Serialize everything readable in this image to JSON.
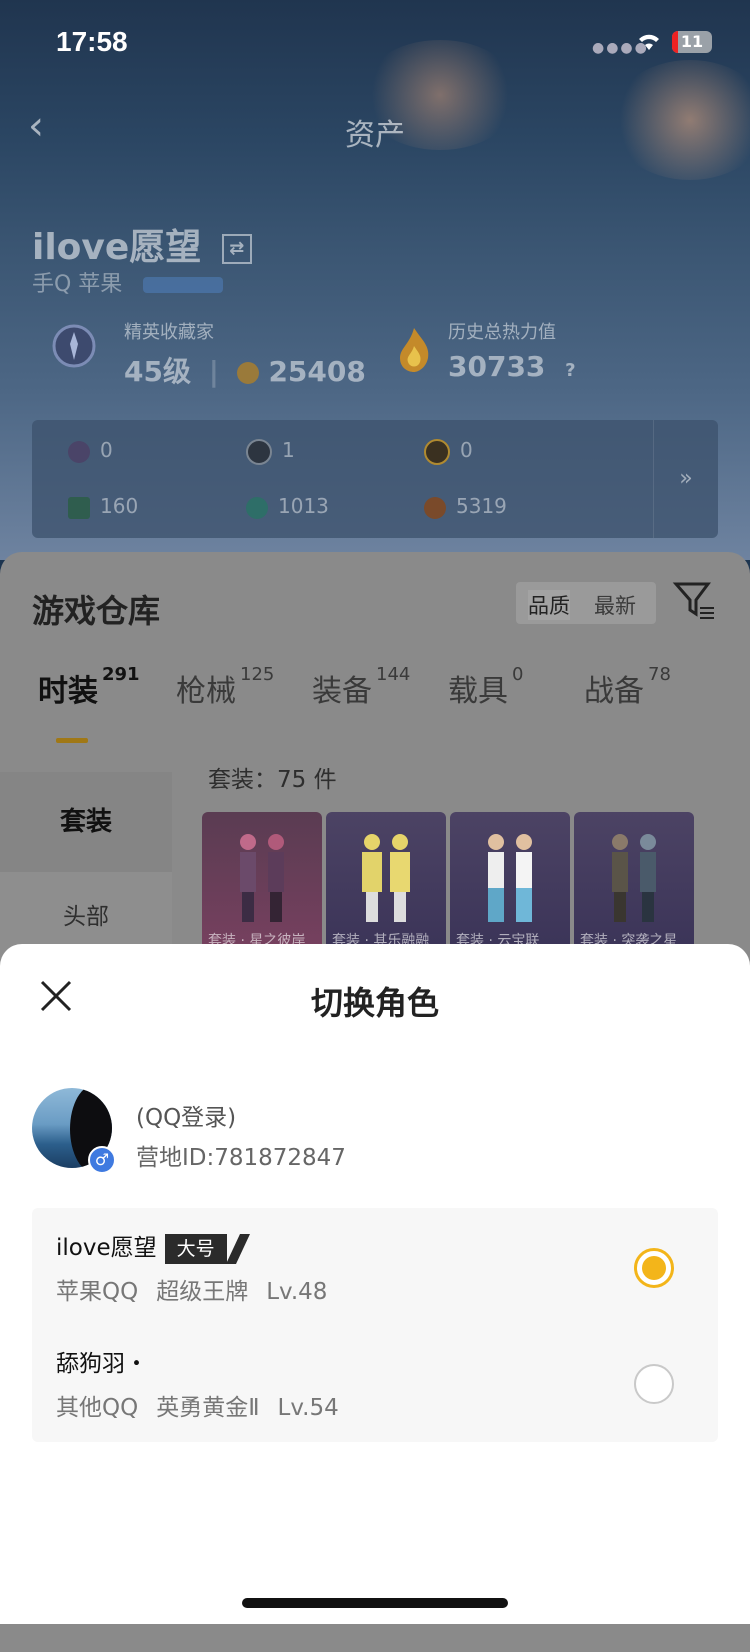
{
  "status_bar": {
    "time": "17:58",
    "battery": "11"
  },
  "nav": {
    "title": "资产",
    "back_icon": "chevron-left-icon"
  },
  "player": {
    "name": "ilove愿望",
    "platform": "手Q 苹果",
    "collector_label": "精英收藏家",
    "collector_level": "45级",
    "collector_points": "25408",
    "heat_label": "历史总热力值",
    "heat_value": "30733",
    "heat_help": "?"
  },
  "resources": {
    "items": [
      {
        "icon": "card-icon",
        "value": "0"
      },
      {
        "icon": "coin-icon",
        "value": "1"
      },
      {
        "icon": "medal-icon",
        "value": "0"
      },
      {
        "icon": "ticket-icon",
        "value": "160"
      },
      {
        "icon": "orb-icon",
        "value": "1013"
      },
      {
        "icon": "gem-icon",
        "value": "5319"
      }
    ],
    "more": "»"
  },
  "warehouse": {
    "title": "游戏仓库",
    "sort": {
      "quality": "品质",
      "newest": "最新"
    },
    "tabs": [
      {
        "label": "时装",
        "count": "291"
      },
      {
        "label": "枪械",
        "count": "125"
      },
      {
        "label": "装备",
        "count": "144"
      },
      {
        "label": "载具",
        "count": "0"
      },
      {
        "label": "战备",
        "count": "78"
      }
    ],
    "side": {
      "item_1": "套装",
      "item_2": "头部"
    },
    "set_count": "套装：75 件",
    "cards": [
      {
        "caption": "套装 · 星之彼岸"
      },
      {
        "caption": "套装 · 其乐融融"
      },
      {
        "caption": "套装 · 云宝联"
      },
      {
        "caption": "套装 · 突袭之星"
      }
    ]
  },
  "sheet": {
    "title": "切换角色",
    "login_text": "(QQ登录)",
    "camp_id": "营地ID:781872847",
    "roles": [
      {
        "name": "ilove愿望",
        "tag": "大号",
        "platform": "苹果QQ",
        "rank": "超级王牌",
        "level": "Lv.48",
        "selected": true
      },
      {
        "name": "舔狗羽・",
        "tag": "",
        "platform": "其他QQ",
        "rank": "英勇黄金Ⅱ",
        "level": "Lv.54",
        "selected": false
      }
    ]
  },
  "colors": {
    "accent": "#f3b51a",
    "tab_underline": "#a07816",
    "gender_badge": "#3f7ae0"
  }
}
